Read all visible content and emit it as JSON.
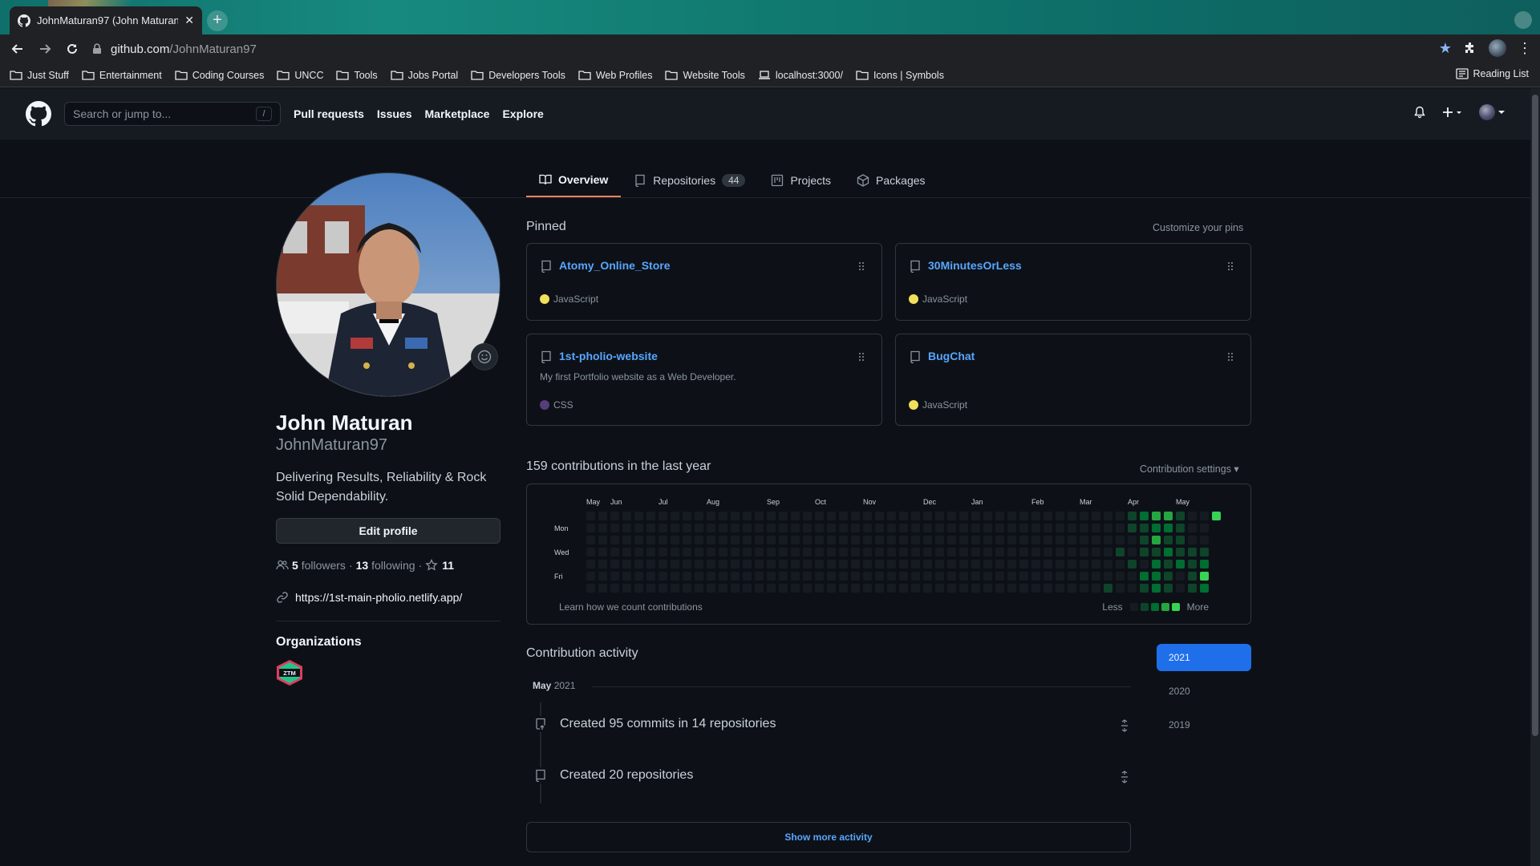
{
  "browser": {
    "tab_title": "JohnMaturan97 (John Maturan)",
    "url_host": "github.com",
    "url_path": "/JohnMaturan97",
    "bookmarks": [
      "Just Stuff",
      "Entertainment",
      "Coding Courses",
      "UNCC",
      "Tools",
      "Jobs Portal",
      "Developers Tools",
      "Web Profiles",
      "Website Tools",
      "localhost:3000/",
      "Icons | Symbols"
    ],
    "reading_list": "Reading List"
  },
  "header": {
    "search_placeholder": "Search or jump to...",
    "slash_key": "/",
    "nav": [
      "Pull requests",
      "Issues",
      "Marketplace",
      "Explore"
    ]
  },
  "tabs": {
    "overview": "Overview",
    "repositories": "Repositories",
    "repositories_count": "44",
    "projects": "Projects",
    "packages": "Packages"
  },
  "profile": {
    "full_name": "John Maturan",
    "username": "JohnMaturan97",
    "bio": "Delivering Results, Reliability & Rock Solid Dependability.",
    "edit_label": "Edit profile",
    "followers_count": "5",
    "followers_label": "followers",
    "following_count": "13",
    "following_label": "following",
    "stars_count": "11",
    "website": "https://1st-main-pholio.netlify.app/",
    "organizations_title": "Organizations",
    "org_badge_text": "ZTM"
  },
  "pinned": {
    "title": "Pinned",
    "customize": "Customize your pins",
    "repos": [
      {
        "name": "Atomy_Online_Store",
        "description": "",
        "language": "JavaScript",
        "lang_color": "#f1e05a"
      },
      {
        "name": "30MinutesOrLess",
        "description": "",
        "language": "JavaScript",
        "lang_color": "#f1e05a"
      },
      {
        "name": "1st-pholio-website",
        "description": "My first Portfolio website as a Web Developer.",
        "language": "CSS",
        "lang_color": "#563d7c"
      },
      {
        "name": "BugChat",
        "description": "",
        "language": "JavaScript",
        "lang_color": "#f1e05a"
      }
    ]
  },
  "contributions": {
    "title": "159 contributions in the last year",
    "settings": "Contribution settings ▾",
    "months": [
      "May",
      "Jun",
      "Jul",
      "Aug",
      "Sep",
      "Oct",
      "Nov",
      "Dec",
      "Jan",
      "Feb",
      "Mar",
      "Apr",
      "May"
    ],
    "day_labels": [
      "Mon",
      "Wed",
      "Fri"
    ],
    "learn": "Learn how we count contributions",
    "legend_less": "Less",
    "legend_more": "More",
    "colors": [
      "#161b22",
      "#0e4429",
      "#006d32",
      "#26a641",
      "#39d353"
    ]
  },
  "activity": {
    "title": "Contribution activity",
    "month": "May",
    "year": "2021",
    "items": [
      {
        "text": "Created 95 commits in 14 repositories"
      },
      {
        "text": "Created 20 repositories"
      }
    ],
    "show_more": "Show more activity",
    "years": [
      "2021",
      "2020",
      "2019"
    ]
  }
}
